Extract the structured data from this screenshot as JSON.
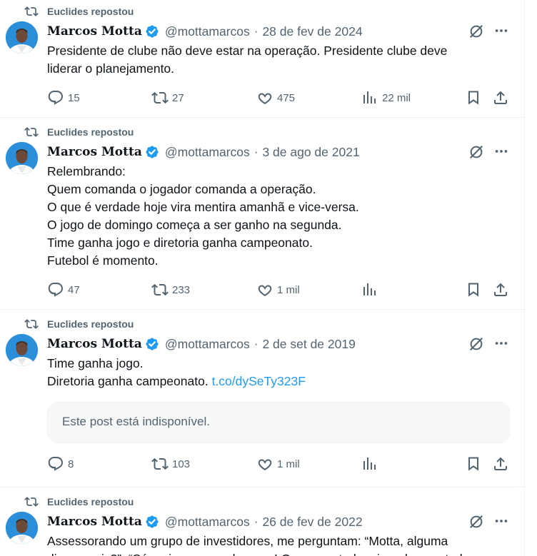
{
  "colors": {
    "accent": "#1d9bf0",
    "muted": "#536471",
    "text": "#0f1419",
    "quote_bg": "#f7f9f9"
  },
  "tweets": [
    {
      "repost_label": "Euclides repostou",
      "author_name": "Marcos Motta",
      "handle": "@mottamarcos",
      "separator": "·",
      "date": "28 de fev de 2024",
      "lines": [
        "Presidente de clube não deve estar na operação. Presidente clube deve",
        "liderar o planejamento."
      ],
      "replies": "15",
      "reposts": "27",
      "likes": "475",
      "views": "22 mil"
    },
    {
      "repost_label": "Euclides repostou",
      "author_name": "Marcos Motta",
      "handle": "@mottamarcos",
      "separator": "·",
      "date": "3 de ago de 2021",
      "lines": [
        "Relembrando:",
        "Quem comanda o jogador comanda a operação.",
        "O que é verdade hoje vira mentira amanhã e vice-versa.",
        "O jogo de domingo começa a ser ganho na segunda.",
        "Time ganha jogo e diretoria ganha campeonato.",
        "Futebol é momento."
      ],
      "replies": "47",
      "reposts": "233",
      "likes": "1 mil",
      "views": ""
    },
    {
      "repost_label": "Euclides repostou",
      "author_name": "Marcos Motta",
      "handle": "@mottamarcos",
      "separator": "·",
      "date": "2 de set de 2019",
      "lines": [
        "Time ganha jogo.",
        "Diretoria ganha campeonato."
      ],
      "link": "t.co/dySeTy323F",
      "quote_text": "Este post está indisponível.",
      "replies": "8",
      "reposts": "103",
      "likes": "1 mil",
      "views": ""
    },
    {
      "repost_label": "Euclides repostou",
      "author_name": "Marcos Motta",
      "handle": "@mottamarcos",
      "separator": "·",
      "date": "26 de fev de 2022",
      "lines": [
        "Assessorando um grupo de investidores, me perguntam: “Motta, alguma",
        "dica a mais?”. “Só mais uma, senhores.. ! Quem controla o jogador, controla"
      ]
    }
  ]
}
